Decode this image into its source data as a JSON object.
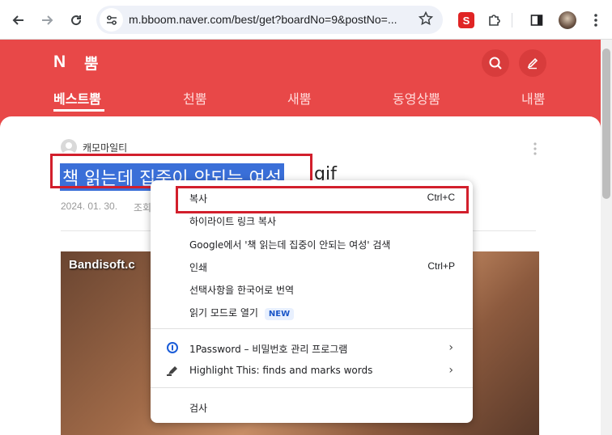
{
  "browser": {
    "url": "m.bboom.naver.com/best/get?boardNo=9&postNo=...",
    "icons": [
      "back-icon",
      "forward-icon",
      "reload-icon",
      "site-settings-icon",
      "bookmark-star-icon",
      "extension-icon",
      "puzzle-icon",
      "side-panel-icon",
      "profile-avatar",
      "kebab-menu-icon"
    ]
  },
  "site": {
    "logo": "N",
    "name": "뿜",
    "nav": [
      "베스트뿜",
      "천뿜",
      "새뿜",
      "동영상뿜",
      "내뿜"
    ],
    "active_tab": "베스트뿜",
    "colors": {
      "brand": "#e84848",
      "selection": "#3a6fd8",
      "highlight_box": "#d21f2c"
    }
  },
  "post": {
    "author": "캐모마일티",
    "title_selected": "책 읽는데 집중이 안되는 여성",
    "title_suffix": ".gif",
    "date": "2024. 01. 30.",
    "views_label": "조회",
    "gif_watermark": "Bandisoft.c"
  },
  "context_menu": {
    "items": [
      {
        "label": "복사",
        "shortcut": "Ctrl+C"
      },
      {
        "label": "하이라이트 링크 복사"
      },
      {
        "label": "Google에서 '책 읽는데 집중이 안되는 여성' 검색"
      },
      {
        "label": "인쇄",
        "shortcut": "Ctrl+P"
      },
      {
        "label": "선택사항을 한국어로 번역"
      },
      {
        "label": "읽기 모드로 열기",
        "badge": "NEW"
      },
      {
        "label": "1Password – 비밀번호 관리 프로그램",
        "submenu": true
      },
      {
        "label": "Highlight This: finds and marks words",
        "submenu": true
      },
      {
        "label": "검사"
      }
    ]
  }
}
